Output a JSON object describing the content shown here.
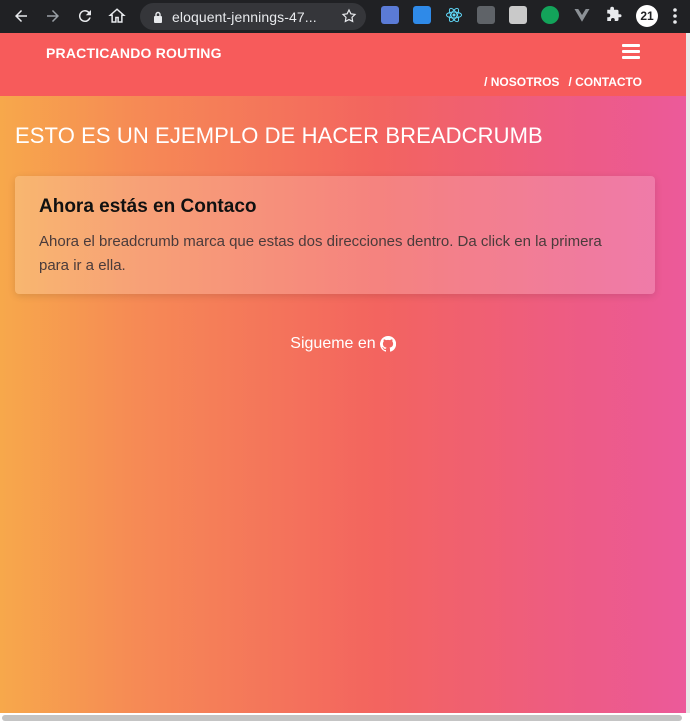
{
  "browser": {
    "url": "eloquent-jennings-47...",
    "extension_badge": "21"
  },
  "navbar": {
    "brand": "PRACTICANDO ROUTING",
    "links": [
      "/ NOSOTROS",
      "/ CONTACTO"
    ]
  },
  "main": {
    "headline": "ESTO ES UN EJEMPLO DE HACER BREADCRUMB",
    "card": {
      "title": "Ahora estás en Contaco",
      "text": "Ahora el breadcrumb marca que estas dos direcciones dentro. Da click en la primera para ir a ella."
    },
    "follow_text": "Sigueme en"
  },
  "colors": {
    "navbar": "#f75b5b",
    "gradient_start": "#f7a84b",
    "gradient_end": "#ec5a9a",
    "chrome_bg": "#202124"
  }
}
